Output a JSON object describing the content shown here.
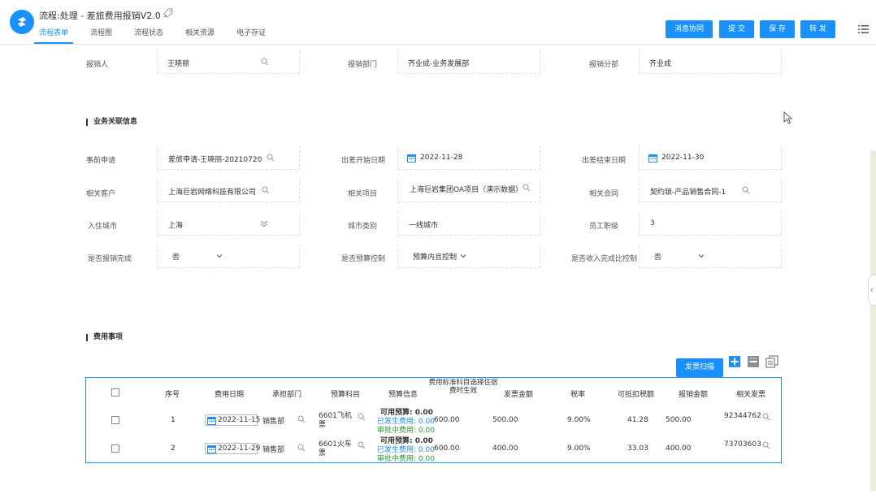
{
  "header": {
    "title": "流程:处理 - 差旅费用报销V2.0 -",
    "tabs": [
      "流程表单",
      "流程图",
      "流程状态",
      "相关资源",
      "电子存证"
    ],
    "buttons": {
      "collaborate": "消息协同",
      "submit": "提 交",
      "save": "保 存",
      "forward": "转 发"
    }
  },
  "basic": {
    "applicant_label": "报销人",
    "applicant_value": "王晓丽",
    "dept_label": "报销部门",
    "dept_value": "齐业成-业务发展部",
    "branch_label": "报销分部",
    "branch_value": "齐业成"
  },
  "business": {
    "section_title": "业务关联信息",
    "pre_request_label": "事前申请",
    "pre_request_value": "差旅申请-王晓丽-20210720",
    "start_date_label": "出差开始日期",
    "start_date_value": "2022-11-28",
    "end_date_label": "出差结束日期",
    "end_date_value": "2022-11-30",
    "customer_label": "相关客户",
    "customer_value": "上海巨岩网络科技有限公司",
    "project_label": "相关项目",
    "project_value": "上海巨岩集团OA项目（演示数据）",
    "contract_label": "相关合同",
    "contract_value": "契约锁-产品销售合同-1",
    "city_label": "入住城市",
    "city_value": "上海",
    "city_type_label": "城市类别",
    "city_type_value": "一线城市",
    "level_label": "员工职级",
    "level_value": "3",
    "done_label": "是否报销完成",
    "done_value": "否",
    "budget_ctrl_label": "是否预算控制",
    "budget_ctrl_value": "预算内且控制",
    "income_label": "是否收入完成比控制",
    "income_value": "否"
  },
  "expense": {
    "section_title": "费用事项",
    "scan_button": "发票扫描",
    "columns": {
      "seq": "序号",
      "date": "费用日期",
      "dept": "承担部门",
      "subject": "预算科目",
      "budget": "预算信息",
      "standard": "费用标准科目选择住宿费时生效",
      "invoice_amount": "发票金额",
      "tax_rate": "税率",
      "deductible": "可抵扣税额",
      "claim_amount": "报销金额",
      "invoice": "相关发票"
    },
    "rows": [
      {
        "seq": "1",
        "date": "2022-11-15",
        "dept": "销售部",
        "subject_line1": "6601飞机",
        "subject_line2": "票",
        "available": "可用预算:  0.00",
        "incurred": "已发生费用:  0.00",
        "pending": "审批中费用:  0.00",
        "standard": "600.00",
        "invoice_amount": "500.00",
        "tax_rate": "9.00%",
        "deductible": "41.28",
        "claim_amount": "500.00",
        "invoice": "92344762"
      },
      {
        "seq": "2",
        "date": "2022-11-29",
        "dept": "销售部",
        "subject_line1": "6601火车",
        "subject_line2": "票",
        "available": "可用预算:  0.00",
        "incurred": "已发生费用:  0.00",
        "pending": "审批中费用:  0.00",
        "standard": "600.00",
        "invoice_amount": "400.00",
        "tax_rate": "9.00%",
        "deductible": "33.03",
        "claim_amount": "400.00",
        "invoice": "73703603"
      }
    ]
  },
  "colors": {
    "primary": "#1890ff",
    "green": "#2f9a3a",
    "border_dashed": "#d6e4ef"
  }
}
